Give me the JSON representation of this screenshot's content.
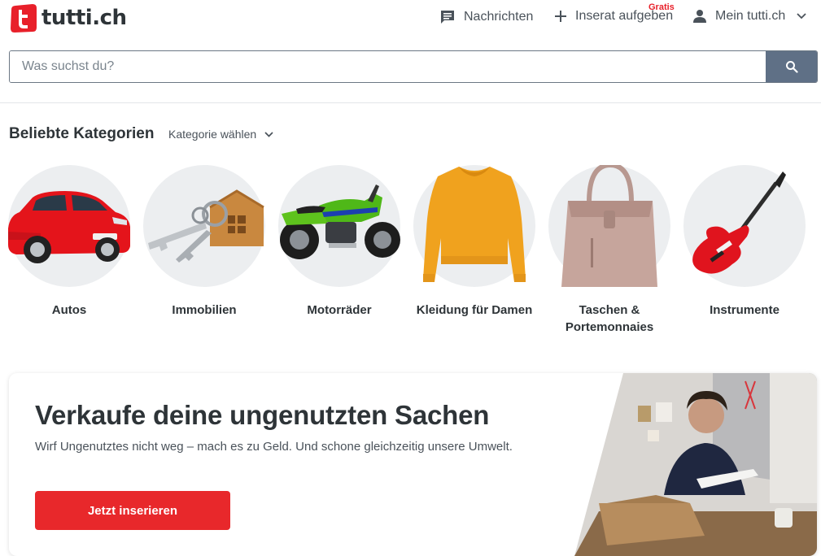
{
  "header": {
    "logo_text": "tutti.ch",
    "nav": {
      "messages": "Nachrichten",
      "post_ad": "Inserat aufgeben",
      "post_ad_badge": "Gratis",
      "account": "Mein tutti.ch"
    }
  },
  "search": {
    "placeholder": "Was suchst du?",
    "value": ""
  },
  "categories": {
    "title": "Beliebte Kategorien",
    "select_label": "Kategorie wählen",
    "items": [
      {
        "label": "Autos",
        "icon": "car-image"
      },
      {
        "label": "Immobilien",
        "icon": "keys-house-image"
      },
      {
        "label": "Motorräder",
        "icon": "motorcycle-image"
      },
      {
        "label": "Kleidung für Damen",
        "icon": "sweater-image"
      },
      {
        "label": "Taschen & Portemonnaies",
        "icon": "handbag-image"
      },
      {
        "label": "Instrumente",
        "icon": "guitar-image"
      }
    ]
  },
  "promo": {
    "title": "Verkaufe deine ungenutzten Sachen",
    "text": "Wirf Ungenutztes nicht weg – mach es zu Geld. Und schone gleichzeitig unsere Umwelt.",
    "button": "Jetzt inserieren"
  },
  "colors": {
    "brand_red": "#e8282b",
    "search_button": "#5f7086",
    "text_dark": "#2e3438"
  }
}
